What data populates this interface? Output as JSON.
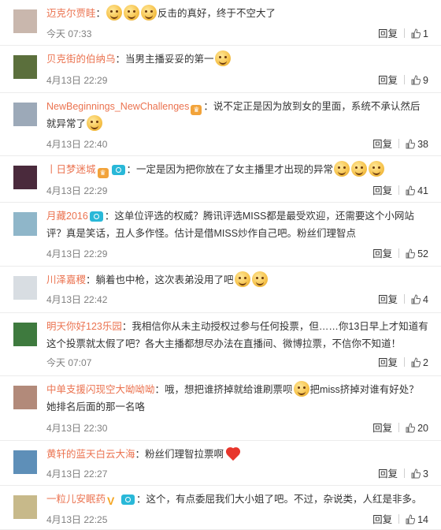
{
  "actions": {
    "reply_label": "回复"
  },
  "comments": [
    {
      "user": "迈克尔贾眭",
      "sep": "：",
      "before": "",
      "emojis_a": 3,
      "text": "反击的真好，终于不空大了",
      "emojis_b": 0,
      "time": "今天 07:33",
      "likes": "1",
      "avatar_color": "#c9b7ad",
      "badges": []
    },
    {
      "user": "贝克街的伯纳乌",
      "sep": "：",
      "text": "当男主播妥妥的第一",
      "emojis_b": 1,
      "time": "4月13日 22:29",
      "likes": "9",
      "avatar_color": "#5b6f3c",
      "badges": []
    },
    {
      "user": "NewBeginnings_NewChallenges",
      "sep": "：",
      "text": "说不定正是因为放到女的里面，系统不承认然后就异常了",
      "emojis_b": 1,
      "time": "4月13日 22:40",
      "likes": "38",
      "avatar_color": "#9ca9b8",
      "badges": [
        "vip"
      ]
    },
    {
      "user": "丨日梦迷城",
      "sep": "：",
      "text": "一定是因为把你放在了女主播里才出现的异常",
      "emojis_b": 3,
      "time": "4月13日 22:29",
      "likes": "41",
      "avatar_color": "#4a2a3c",
      "badges": [
        "vip",
        "cam"
      ]
    },
    {
      "user": "月藏2016",
      "sep": "：",
      "text": "这单位评选的权威？腾讯评选MISS都是最受欢迎，还需要这个小网站评？真是笑话，丑人多作怪。估计是借MISS炒作自己吧。粉丝们理智点",
      "emojis_b": 0,
      "time": "4月13日 22:29",
      "likes": "52",
      "avatar_color": "#8fb6c9",
      "badges": [
        "cam"
      ]
    },
    {
      "user": "川泽嘉稷",
      "sep": "：",
      "text": "躺着也中枪，这次表弟没用了吧",
      "emojis_b": 2,
      "time": "4月13日 22:42",
      "likes": "4",
      "avatar_color": "#d8dde2",
      "badges": []
    },
    {
      "user": "明天你好123乐园",
      "sep": "：",
      "text": "我相信你从未主动授权过参与任何投票，但……你13日早上才知道有这个投票就太假了吧？各大主播都想尽办法在直播间、微博拉票，不信你不知道！",
      "emojis_b": 0,
      "time": "今天 07:07",
      "likes": "2",
      "avatar_color": "#3e7a3e",
      "badges": []
    },
    {
      "user": "中单支援闪现空大呦呦呦",
      "sep": "：",
      "text": "哦，想把谁挤掉就给谁刷票呗",
      "emojis_b": 1,
      "text2": "把miss挤掉对谁有好处？她排名后面的那一名咯",
      "time": "4月13日 22:30",
      "likes": "20",
      "avatar_color": "#b28a7a",
      "badges": []
    },
    {
      "user": "黄轩的蓝天白云大海",
      "sep": "：",
      "text": "粉丝们理智拉票啊",
      "heart": true,
      "time": "4月13日 22:27",
      "likes": "3",
      "avatar_color": "#5e8fb8",
      "badges": []
    },
    {
      "user": "一粒儿安眠药",
      "sep": "：",
      "text": "这个，有点委屈我们大小姐了吧。不过，杂说类，人红是非多。",
      "emojis_b": 0,
      "time": "4月13日 22:25",
      "likes": "14",
      "avatar_color": "#c7b98a",
      "badges": [
        "v",
        "cam"
      ]
    }
  ]
}
